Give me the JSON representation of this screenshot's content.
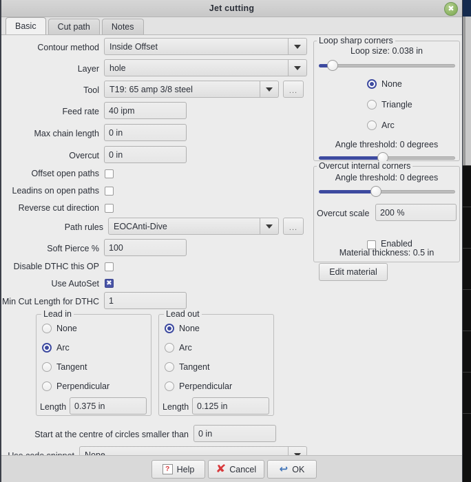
{
  "window": {
    "title": "Jet cutting",
    "close_label": "✖"
  },
  "tabs": [
    {
      "label": "Basic",
      "active": true
    },
    {
      "label": "Cut path",
      "active": false
    },
    {
      "label": "Notes",
      "active": false
    }
  ],
  "left_form": {
    "contour_method": {
      "label": "Contour method",
      "value": "Inside Offset"
    },
    "layer": {
      "label": "Layer",
      "value": "hole"
    },
    "tool": {
      "label": "Tool",
      "value": "T19: 65 amp 3/8 steel",
      "more_label": "..."
    },
    "feed_rate": {
      "label": "Feed rate",
      "value": "40 ipm"
    },
    "max_chain_length": {
      "label": "Max chain length",
      "value": "0 in"
    },
    "overcut": {
      "label": "Overcut",
      "value": "0 in"
    },
    "offset_open_paths": {
      "label": "Offset open paths",
      "checked": false
    },
    "leadins_on_open_paths": {
      "label": "Leadins on open paths",
      "checked": false
    },
    "reverse_cut_direction": {
      "label": "Reverse cut direction",
      "checked": false
    },
    "path_rules": {
      "label": "Path rules",
      "value": "EOCAnti-Dive",
      "more_label": "..."
    },
    "soft_pierce": {
      "label": "Soft Pierce %",
      "value": "100"
    },
    "disable_dthc": {
      "label": "Disable DTHC this OP",
      "checked": false
    },
    "use_autoset": {
      "label": "Use AutoSet",
      "checked": true,
      "mark": "✖"
    },
    "min_cut_length": {
      "label": "Min Cut Length for DTHC",
      "value": "1"
    }
  },
  "lead_in": {
    "title": "Lead in",
    "options": [
      "None",
      "Arc",
      "Tangent",
      "Perpendicular"
    ],
    "selected": "Arc",
    "length_label": "Length",
    "length_value": "0.375 in"
  },
  "lead_out": {
    "title": "Lead out",
    "options": [
      "None",
      "Arc",
      "Tangent",
      "Perpendicular"
    ],
    "selected": "None",
    "length_label": "Length",
    "length_value": "0.125 in"
  },
  "bottom_form": {
    "start_centre": {
      "label": "Start at the centre of circles smaller than",
      "value": "0 in"
    },
    "code_snippet": {
      "label": "Use code snippet",
      "value": "None"
    }
  },
  "loop_sharp_corners": {
    "title": "Loop sharp corners",
    "loop_size_text": "Loop size: 0.038 in",
    "loop_size_percent": 10,
    "options": [
      "None",
      "Triangle",
      "Arc"
    ],
    "selected": "None",
    "angle_threshold_text": "Angle threshold: 0 degrees",
    "angle_threshold_percent": 47
  },
  "overcut_internal_corners": {
    "title": "Overcut internal corners",
    "angle_threshold_text": "Angle threshold: 0 degrees",
    "angle_threshold_percent": 42,
    "overcut_scale_label": "Overcut scale",
    "overcut_scale_value": "200 %",
    "enabled_label": "Enabled",
    "enabled_checked": false
  },
  "material": {
    "thickness_text": "Material thickness: 0.5 in",
    "edit_label": "Edit material"
  },
  "footer": {
    "help_label": "Help",
    "cancel_label": "Cancel",
    "ok_label": "OK",
    "help_icon": "☷",
    "cancel_icon": "✘",
    "ok_icon": "↩"
  },
  "colors": {
    "accent": "#3d4aa0",
    "danger": "#d8393c",
    "ok": "#3f73b8",
    "close": "#8bb361"
  }
}
